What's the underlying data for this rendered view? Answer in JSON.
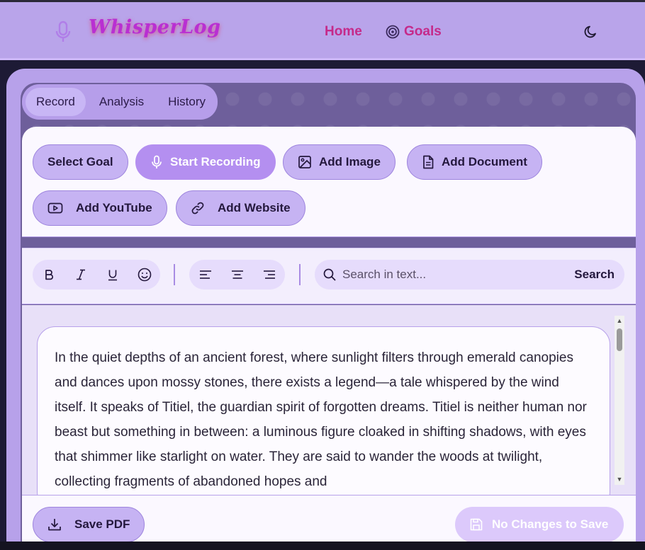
{
  "app": {
    "logo_text": "WhisperLog"
  },
  "nav": {
    "home": "Home",
    "goals": "Goals"
  },
  "tabs": [
    {
      "label": "Record",
      "active": true
    },
    {
      "label": "Analysis",
      "active": false
    },
    {
      "label": "History",
      "active": false
    }
  ],
  "actions": {
    "select_goal": "Select Goal",
    "start_recording": "Start Recording",
    "add_image": "Add Image",
    "add_document": "Add Document",
    "add_youtube": "Add YouTube",
    "add_website": "Add Website"
  },
  "format": {
    "bold_icon": "bold-icon",
    "italic_icon": "italic-icon",
    "underline_icon": "underline-icon",
    "emoji_icon": "emoji-icon",
    "align_left_icon": "align-left-icon",
    "align_center_icon": "align-center-icon",
    "align_right_icon": "align-right-icon"
  },
  "search": {
    "placeholder": "Search in text...",
    "button": "Search"
  },
  "editor": {
    "text": "In the quiet depths of an ancient forest, where sunlight filters through emerald canopies and dances upon mossy stones, there exists a legend—a tale whispered by the wind itself. It speaks of Titiel, the guardian spirit of forgotten dreams. Titiel is neither human nor beast but something in between: a luminous figure cloaked in shifting shadows, with eyes that shimmer like starlight on water. They are said to wander the woods at twilight, collecting fragments of abandoned hopes and"
  },
  "footer": {
    "save_pdf": "Save PDF",
    "no_changes": "No Changes to Save"
  },
  "colors": {
    "accent": "#b48ff0",
    "header_bg": "#b9a4ea",
    "nav_link": "#c52a8a",
    "logo": "#b92fd2"
  }
}
